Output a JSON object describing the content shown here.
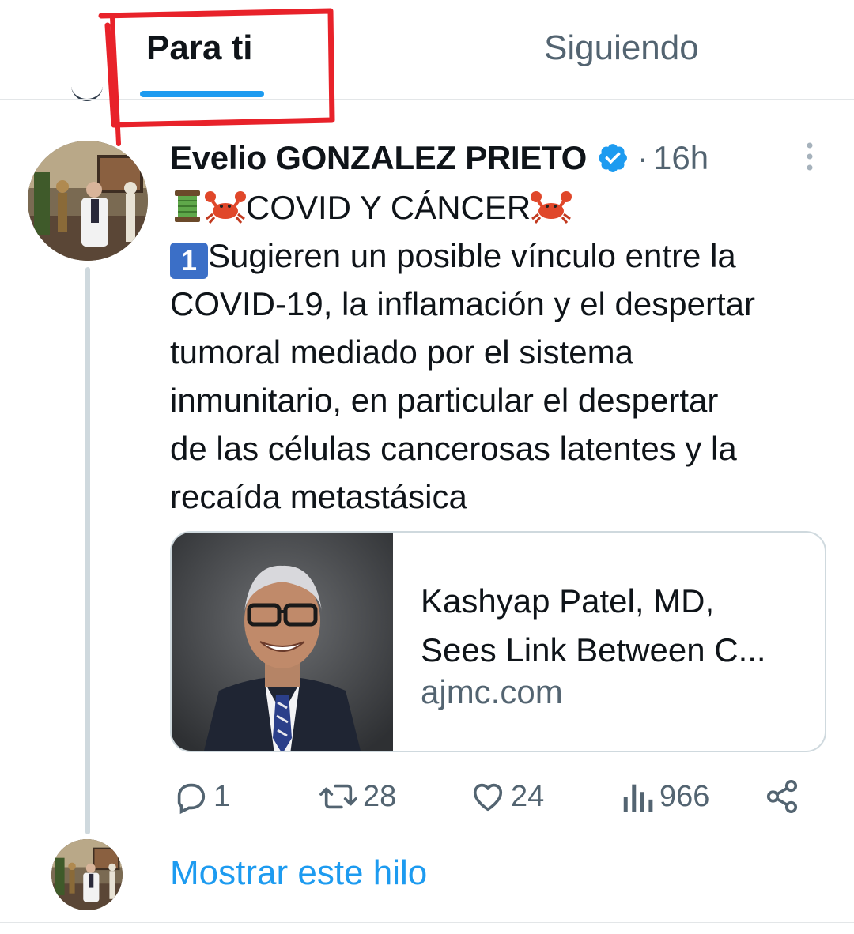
{
  "tabs": {
    "for_you": "Para ti",
    "following": "Siguiendo"
  },
  "tweet": {
    "author_name": "Evelio GONZALEZ PRIETO",
    "separator": "·",
    "timestamp": "16h",
    "line1_text": "COVID Y CÁNCER",
    "line2_text": "Sugieren un posible vínculo entre la",
    "line3": "COVID-19, la inflamación y el despertar",
    "line4": "tumoral mediado por el sistema",
    "line5": "inmunitario, en particular el despertar",
    "line6": "de las células cancerosas latentes y la",
    "line7": "recaída metastásica",
    "number_emoji": "1"
  },
  "card": {
    "title_line1": "Kashyap Patel, MD,",
    "title_line2": "Sees Link Between C...",
    "domain": "ajmc.com"
  },
  "actions": {
    "replies": "1",
    "retweets": "28",
    "likes": "24",
    "views": "966"
  },
  "show_thread": "Mostrar este hilo",
  "colors": {
    "accent": "#1d9bf0",
    "annotation": "#e8222a",
    "muted": "#536471"
  },
  "icons": [
    "verified-icon",
    "more-icon",
    "spool-icon",
    "crab-icon",
    "keycap-one-icon",
    "reply-icon",
    "retweet-icon",
    "like-icon",
    "views-icon",
    "share-icon"
  ]
}
